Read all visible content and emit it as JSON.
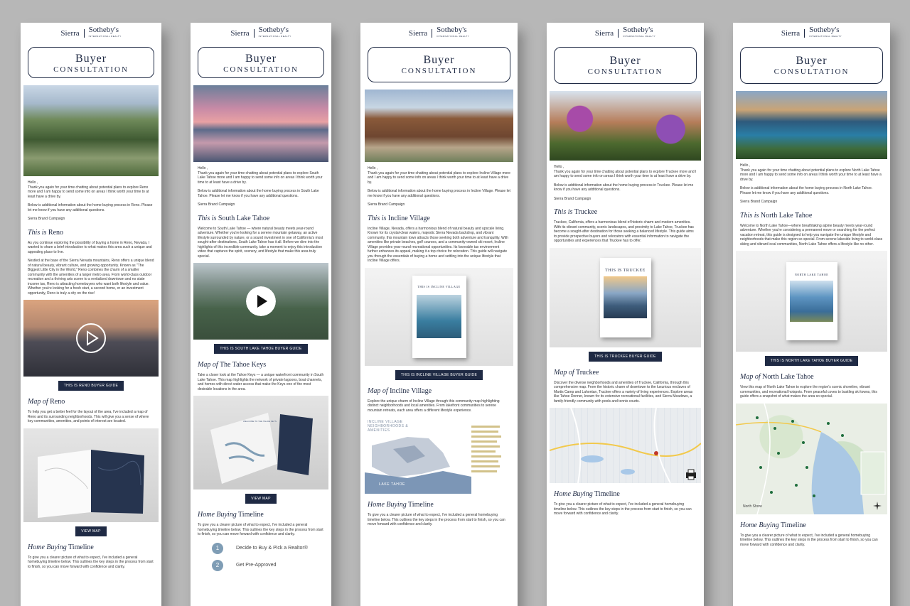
{
  "logo": {
    "sierra": "Sierra",
    "sothebys": "Sotheby's",
    "sub": "INTERNATIONAL REALTY"
  },
  "banner": {
    "line1": "Buyer",
    "line2": "CONSULTATION"
  },
  "common": {
    "hello": "Hello ,",
    "signature": "Sierra Brand Campaign",
    "view_map": "VIEW MAP",
    "timeline_pre": "Home Buying",
    "timeline_post": "Timeline",
    "timeline_text": "To give you a clearer picture of what to expect, I've included a general homebuying timeline below. This outlines the key steps in the process from start to finish, so you can move forward with confidence and clarity.",
    "this_is": "This is",
    "map_of": "Map of"
  },
  "emails": [
    {
      "area": "Reno",
      "intro": "Thank you again for your time chatting about potential plans to explore Reno more and I am happy to send some info on areas I think worth your time to at least have a drive by.",
      "more": "Below is additional information about the home buying process in Reno. Please let me know if you have any additional questions.",
      "body": "As you continue exploring the possibility of buying a home in Reno, Nevada, I wanted to share a brief introduction to what makes this area such a unique and appealing place to live.",
      "body2": "Nestled at the base of the Sierra Nevada mountains, Reno offers a unique blend of natural beauty, vibrant culture, and growing opportunity. Known as \"The Biggest Little City in the World,\" Reno combines the charm of a smaller community with the amenities of a larger metro area. From world-class outdoor recreation and a thriving arts scene to a revitalized downtown and no state income tax, Reno is attracting homebuyers who want both lifestyle and value. Whether you're looking for a fresh start, a second home, or an investment opportunity, Reno is truly a city on the rise!",
      "guide": "THIS IS RENO BUYER GUIDE",
      "map_text": "To help you get a better feel for the layout of the area, I've included a map of Reno and its surrounding neighborhoods. This will give you a sense of where key communities, amenities, and points of interest are located."
    },
    {
      "area": "South Lake Tahoe",
      "intro": "Thank you again for your time chatting about potential plans to explore South Lake Tahoe more and I am happy to send some info on areas I think worth your time to at least have a drive by.",
      "more": "Below is additional information about the home buying process in South Lake Tahoe. Please let me know if you have any additional questions.",
      "body": "Welcome to South Lake Tahoe — where natural beauty meets year-round adventure. Whether you're looking for a serene mountain getaway, an active lifestyle surrounded by nature, or a sound investment in one of California's most sought-after destinations, South Lake Tahoe has it all. Before we dive into the highlights of this incredible community, take a moment to enjoy this introduction video that captures the spirit, scenery, and lifestyle that make this area truly special.",
      "guide": "THIS IS SOUTH LAKE TAHOE BUYER GUIDE",
      "map_title": "The Tahoe Keys",
      "map_text": "Take a closer look at the Tahoe Keys — a unique waterfront community in South Lake Tahoe. This map highlights the network of private lagoons, boat channels, and homes with direct water access that make the Keys one of the most desirable locations in the area.",
      "book_title": "WELCOME TO THE TAHOE KEYS",
      "step1": "Decide to Buy & Pick a Realtor®",
      "step2": "Get Pre-Approved"
    },
    {
      "area": "Incline Village",
      "intro": "Thank you again for your time chatting about potential plans to explore Incline Village more and I am happy to send some info on areas I think worth your time to at least have a drive by.",
      "more": "Below is additional information about the home buying process in Incline Village. Please let me know if you have any additional questions.",
      "body": "Incline Village, Nevada, offers a harmonious blend of natural beauty and upscale living. Known for its crystal-clear waters, majestic Sierra Nevada backdrop, and vibrant community, this mountain town attracts those seeking both adventure and tranquility. With amenities like private beaches, golf courses, and a community-owned ski resort, Incline Village provides year-round recreational opportunities. Its favorable tax environment further enhances its appeal, making it a top choice for relocation. This guide will navigate you through the essentials of buying a home and settling into the unique lifestyle that Incline Village offers.",
      "guide": "THIS IS INCLINE VILLAGE BUYER GUIDE",
      "book_title": "THIS IS INCLINE VILLAGE",
      "map_text": "Explore the unique charm of Incline Village through this community map highlighting distinct neighborhoods and local amenities. From lakefront communities to serene mountain retreats, each area offers a different lifestyle experience.",
      "map_heading": "INCLINE VILLAGE NEIGHBORHOODS & AMENITIES",
      "lake_label": "LAKE TAHOE"
    },
    {
      "area": "Truckee",
      "intro": "Thank you again for your time chatting about potential plans to explore Truckee more and I am happy to send some info on areas I think worth your time to at least have a drive by.",
      "more": "Below is additional information about the home buying process in Truckee. Please let me know if you have any additional questions.",
      "body": "Truckee, California, offers a harmonious blend of historic charm and modern amenities. With its vibrant community, scenic landscapes, and proximity to Lake Tahoe, Truckee has become a sought-after destination for those seeking a balanced lifestyle. This guide aims to provide prospective buyers and relocators with essential information to navigate the opportunities and experiences that Truckee has to offer.",
      "guide": "THIS IS TRUCKEE BUYER GUIDE",
      "book_title": "THIS IS TRUCKEE",
      "map_text": "Discover the diverse neighborhoods and amenities of Truckee, California, through this comprehensive map. From the historic charm of downtown to the luxurious enclaves of Martis Camp and Lahontan, Truckee offers a variety of living experiences. Explore areas like Tahoe Donner, known for its extensive recreational facilities, and Sierra Meadows, a family-friendly community with pools and tennis courts."
    },
    {
      "area": "North Lake Tahoe",
      "intro": "Thank you again for your time chatting about potential plans to explore North Lake Tahoe more and I am happy to send some info on areas I think worth your time to at least have a drive by.",
      "more": "Below is additional information about the home buying process in North Lake Tahoe. Please let me know if you have any additional questions.",
      "body": "Welcome to North Lake Tahoe—where breathtaking alpine beauty meets year-round adventure. Whether you're considering a permanent move or searching for the perfect vacation retreat, this guide is designed to help you navigate the unique lifestyle and neighborhoods that make this region so special. From serene lakeside living to world-class skiing and vibrant local communities, North Lake Tahoe offers a lifestyle like no other.",
      "guide": "THIS IS NORTH LAKE TAHOE BUYER GUIDE",
      "book_title": "NORTH LAKE TAHOE",
      "map_text": "View this map of North Lake Tahoe to explore the region's scenic shoreline, vibrant communities, and recreational hotspots. From peaceful coves to bustling ski towns, this guide offers a snapshot of what makes the area so special.",
      "map_label": "North Shore"
    }
  ]
}
